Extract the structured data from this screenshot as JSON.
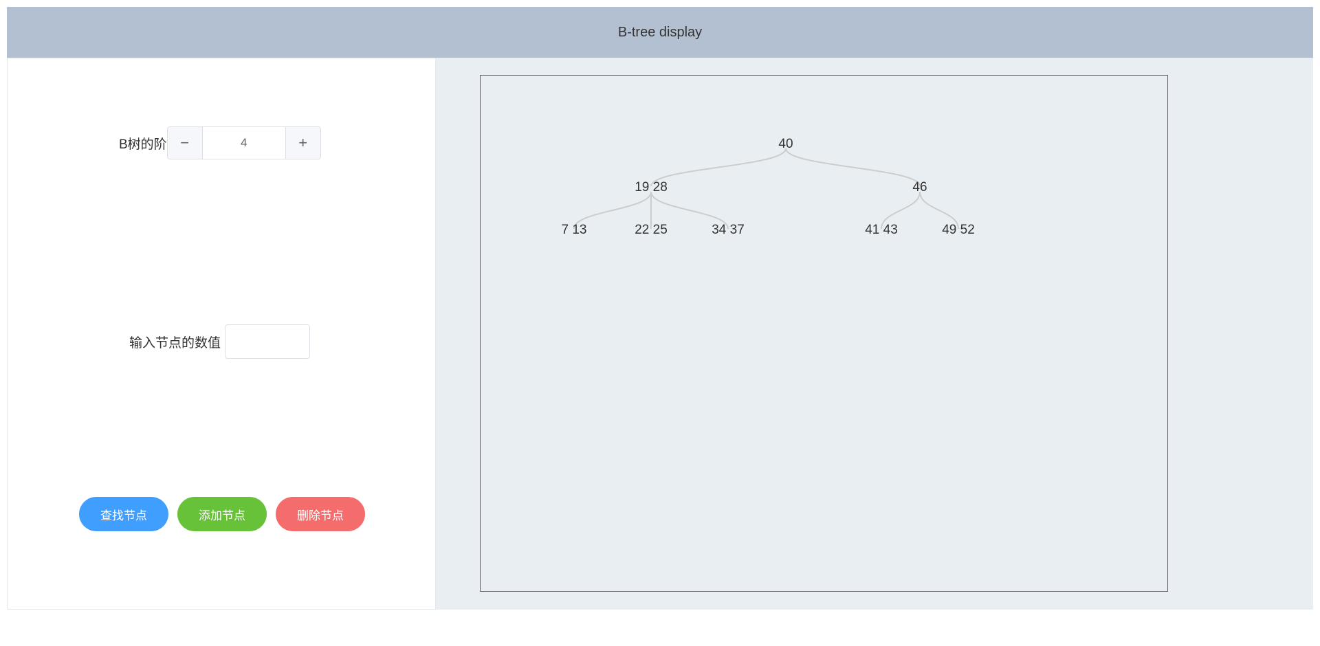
{
  "header": {
    "title": "B-tree display"
  },
  "form": {
    "order_label": "B树的阶",
    "order_value": "4",
    "minus_symbol": "−",
    "plus_symbol": "+",
    "node_value_label": "输入节点的数值",
    "node_value": ""
  },
  "buttons": {
    "find_label": "查找节点",
    "add_label": "添加节点",
    "delete_label": "删除节点"
  },
  "colors": {
    "header_bg": "#b3c0d1",
    "main_bg": "#e9eef3",
    "find": "#409eff",
    "add": "#67c23a",
    "delete": "#f56c6c",
    "link": "#cccccc"
  },
  "tree": {
    "keys": "40",
    "children": [
      {
        "keys": "19 28",
        "children": [
          {
            "keys": "7 13"
          },
          {
            "keys": "22 25"
          },
          {
            "keys": "34 37"
          }
        ]
      },
      {
        "keys": "46",
        "children": [
          {
            "keys": "41 43"
          },
          {
            "keys": "49 52"
          }
        ]
      }
    ]
  }
}
